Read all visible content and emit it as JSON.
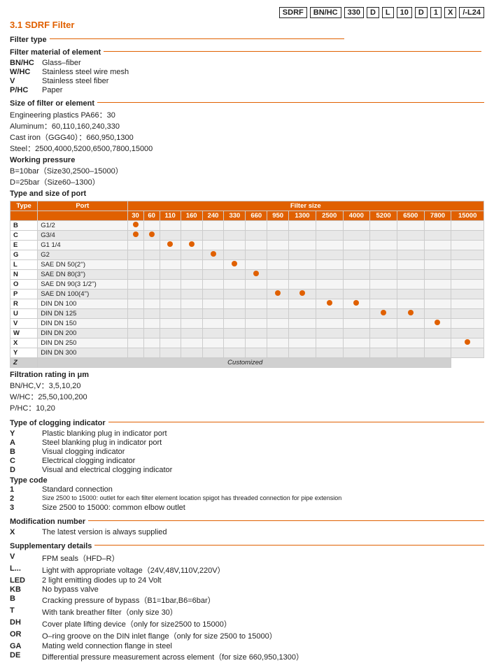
{
  "title": "3.1 SDRF Filter",
  "model_parts": [
    "SDRF",
    "BN/HC",
    "330",
    "D",
    "L",
    "10",
    "D",
    "1",
    "X",
    "/-L24"
  ],
  "filter_type_label": "Filter type",
  "filter_material_label": "Filter material of element",
  "filter_materials": [
    {
      "code": "BN/HC",
      "desc": "Glass–fiber"
    },
    {
      "code": "W/HC",
      "desc": "Stainless steel wire mesh"
    },
    {
      "code": "V",
      "desc": "Stainless steel fiber"
    },
    {
      "code": "P/HC",
      "desc": "Paper"
    }
  ],
  "size_label": "Size of filter or element",
  "size_items": [
    "Engineering plastics PA66：30",
    "Aluminum：60,110,160,240,330",
    "Cast iron（GGG40）：660,950,1300",
    "Steel：2500,4000,5200,6500,7800,15000"
  ],
  "working_pressure_label": "Working pressure",
  "working_pressure_items": [
    "B=10bar（Size30,2500–15000）",
    "D=25bar（Size60–1300）"
  ],
  "port_label": "Type and size of port",
  "table_header": {
    "type": "Type",
    "port": "Port",
    "filter_size": "Filter size",
    "sizes": [
      "30",
      "60",
      "110",
      "160",
      "240",
      "330",
      "660",
      "950",
      "1300",
      "2500",
      "4000",
      "5200",
      "6500",
      "7800",
      "15000"
    ]
  },
  "table_rows": [
    {
      "type": "B",
      "port": "G1/2",
      "dots": [
        1,
        0,
        0,
        0,
        0,
        0,
        0,
        0,
        0,
        0,
        0,
        0,
        0,
        0,
        0
      ]
    },
    {
      "type": "C",
      "port": "G3/4",
      "dots": [
        1,
        1,
        0,
        0,
        0,
        0,
        0,
        0,
        0,
        0,
        0,
        0,
        0,
        0,
        0
      ]
    },
    {
      "type": "E",
      "port": "G1 1/4",
      "dots": [
        0,
        0,
        1,
        1,
        0,
        0,
        0,
        0,
        0,
        0,
        0,
        0,
        0,
        0,
        0
      ]
    },
    {
      "type": "G",
      "port": "G2",
      "dots": [
        0,
        0,
        0,
        0,
        1,
        0,
        0,
        0,
        0,
        0,
        0,
        0,
        0,
        0,
        0
      ]
    },
    {
      "type": "L",
      "port": "SAE DN 50(2'')",
      "dots": [
        0,
        0,
        0,
        0,
        0,
        1,
        0,
        0,
        0,
        0,
        0,
        0,
        0,
        0,
        0
      ]
    },
    {
      "type": "N",
      "port": "SAE DN 80(3'')",
      "dots": [
        0,
        0,
        0,
        0,
        0,
        0,
        1,
        0,
        0,
        0,
        0,
        0,
        0,
        0,
        0
      ]
    },
    {
      "type": "O",
      "port": "SAE DN 90(3 1/2'')",
      "dots": [
        0,
        0,
        0,
        0,
        0,
        0,
        0,
        0,
        0,
        0,
        0,
        0,
        0,
        0,
        0
      ]
    },
    {
      "type": "P",
      "port": "SAE DN 100(4'')",
      "dots": [
        0,
        0,
        0,
        0,
        0,
        0,
        0,
        1,
        1,
        0,
        0,
        0,
        0,
        0,
        0
      ]
    },
    {
      "type": "R",
      "port": "DIN DN 100",
      "dots": [
        0,
        0,
        0,
        0,
        0,
        0,
        0,
        0,
        0,
        1,
        1,
        0,
        0,
        0,
        0
      ]
    },
    {
      "type": "U",
      "port": "DIN DN 125",
      "dots": [
        0,
        0,
        0,
        0,
        0,
        0,
        0,
        0,
        0,
        0,
        0,
        1,
        1,
        0,
        0
      ]
    },
    {
      "type": "V",
      "port": "DIN DN 150",
      "dots": [
        0,
        0,
        0,
        0,
        0,
        0,
        0,
        0,
        0,
        0,
        0,
        0,
        0,
        1,
        0
      ]
    },
    {
      "type": "W",
      "port": "DIN DN 200",
      "dots": [
        0,
        0,
        0,
        0,
        0,
        0,
        0,
        0,
        0,
        0,
        0,
        0,
        0,
        0,
        0
      ]
    },
    {
      "type": "X",
      "port": "DIN DN 250",
      "dots": [
        0,
        0,
        0,
        0,
        0,
        0,
        0,
        0,
        0,
        0,
        0,
        0,
        0,
        0,
        1
      ]
    },
    {
      "type": "Y",
      "port": "DIN DN 300",
      "dots": [
        0,
        0,
        0,
        0,
        0,
        0,
        0,
        0,
        0,
        0,
        0,
        0,
        0,
        0,
        0
      ]
    },
    {
      "type": "Z",
      "port": "Customized",
      "customized": true,
      "dots": [
        0,
        0,
        0,
        0,
        0,
        0,
        0,
        0,
        0,
        0,
        0,
        0,
        0,
        0,
        0
      ]
    }
  ],
  "filtration_label": "Filtration rating in μm",
  "filtration_items": [
    "BN/HC,V：3,5,10,20",
    "W/HC：25,50,100,200",
    "P/HC：10,20"
  ],
  "clogging_label": "Type of clogging indicator",
  "clogging_items": [
    {
      "code": "Y",
      "desc": "Plastic blanking plug in indicator port"
    },
    {
      "code": "A",
      "desc": "Steel blanking plug in indicator port"
    },
    {
      "code": "B",
      "desc": "Visual clogging indicator"
    },
    {
      "code": "C",
      "desc": "Electrical clogging indicator"
    },
    {
      "code": "D",
      "desc": "Visual and electrical clogging indicator"
    }
  ],
  "type_code_label": "Type code",
  "type_code_items": [
    {
      "code": "1",
      "desc": "Standard connection"
    },
    {
      "code": "2",
      "desc": "Size 2500 to 15000: outlet for each filter element location spigot has threaded connection for pipe extension"
    },
    {
      "code": "3",
      "desc": "Size 2500 to 15000: common elbow outlet"
    }
  ],
  "modification_label": "Modification number",
  "modification_items": [
    {
      "code": "X",
      "desc": "The latest version is always supplied"
    }
  ],
  "supplementary_label": "Supplementary details",
  "supplementary_items": [
    {
      "code": "V",
      "desc": "FPM seals（HFD–R）"
    },
    {
      "code": "L...",
      "desc": "Light with appropriate voltage（24V,48V,110V,220V）"
    },
    {
      "code": "LED",
      "desc": "2 light emitting diodes up to 24 Volt"
    },
    {
      "code": "KB",
      "desc": "No bypass valve"
    },
    {
      "code": "B",
      "desc": "Cracking pressure of bypass（B1=1bar,B6=6bar）"
    },
    {
      "code": "T",
      "desc": "With tank breather filter（only size 30）"
    },
    {
      "code": "DH",
      "desc": "Cover plate lifting device（only for size2500 to 15000）"
    },
    {
      "code": "OR",
      "desc": "O–ring groove on the DIN inlet flange（only for size 2500 to 15000）"
    },
    {
      "code": "GA",
      "desc": "Mating weld connection flange in steel"
    },
    {
      "code": "DE",
      "desc": "Differential pressure measurement across element（for size 660,950,1300）"
    }
  ]
}
